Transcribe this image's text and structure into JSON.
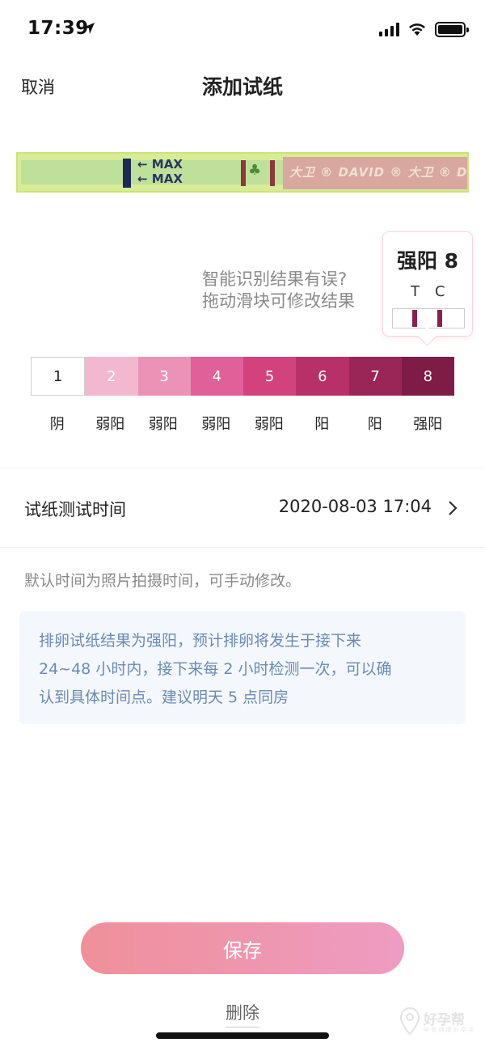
{
  "status_bar": {
    "time": "17:39"
  },
  "nav": {
    "cancel_label": "取消",
    "title": "添加试纸"
  },
  "strip_image": {
    "max_label_1": "← MAX",
    "max_label_2": "← MAX",
    "brand_text": "大卫 ® DAVID ® 大卫 ® DAVID ® 大卫 ® DAVID"
  },
  "hint": {
    "line1": "智能识别结果有误?",
    "line2": "拖动滑块可修改结果"
  },
  "selected": {
    "title": "强阳 8",
    "t_label": "T",
    "c_label": "C",
    "line_color": "#8c1f50"
  },
  "scale": {
    "levels": [
      {
        "num": "1",
        "label": "阴",
        "color": "#ffffff",
        "text_color": "#222222"
      },
      {
        "num": "2",
        "label": "弱阳",
        "color": "#f2b8d0",
        "text_color": "#ffffff"
      },
      {
        "num": "3",
        "label": "弱阳",
        "color": "#ec92b6",
        "text_color": "#ffffff"
      },
      {
        "num": "4",
        "label": "弱阳",
        "color": "#e0609a",
        "text_color": "#ffffff"
      },
      {
        "num": "5",
        "label": "弱阳",
        "color": "#d2437e",
        "text_color": "#ffffff"
      },
      {
        "num": "6",
        "label": "阳",
        "color": "#b83068",
        "text_color": "#ffffff"
      },
      {
        "num": "7",
        "label": "阳",
        "color": "#9a2657",
        "text_color": "#ffffff"
      },
      {
        "num": "8",
        "label": "强阳",
        "color": "#7e1c46",
        "text_color": "#ffffff"
      }
    ]
  },
  "test_time": {
    "label": "试纸测试时间",
    "value": "2020-08-03 17:04"
  },
  "note": "默认时间为照片拍摄时间，可手动修改。",
  "advice": {
    "line1": "排卵试纸结果为强阳，预计排卵将发生于接下来",
    "line2": "24~48 小时内，接下来每 2 小时检测一次，可以确",
    "line3": "认到具体时间点。建议明天 5 点同房"
  },
  "actions": {
    "save_label": "保存",
    "delete_label": "删除"
  },
  "watermark": {
    "text": "好孕帮",
    "sub": "孕 育 健 康 好 帮 手"
  }
}
